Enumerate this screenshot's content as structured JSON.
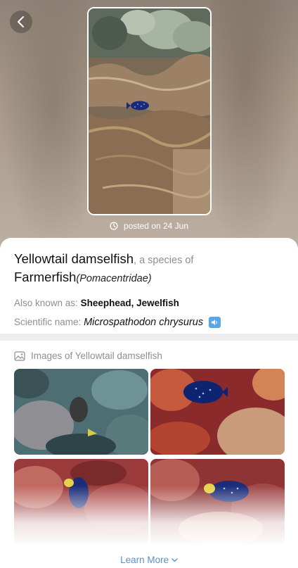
{
  "header": {
    "back_icon": "chevron-left-icon",
    "posted_label": "posted on 24 Jun",
    "posted_icon": "clock-icon"
  },
  "species": {
    "common_name": "Yellowtail damselfish",
    "species_of": ", a species of",
    "family_common": "Farmerfish",
    "family_scientific": "(Pomacentridae)",
    "aka_label": "Also known as: ",
    "aka_value": "Sheephead, Jewelfish",
    "sci_label": "Scientific name: ",
    "sci_value": "Microspathodon chrysurus",
    "speaker_icon": "speaker-icon"
  },
  "images_section": {
    "title": "Images of Yellowtail damselfish",
    "icon": "image-icon",
    "thumbnails": [
      "fish-photo-1",
      "fish-photo-2",
      "fish-photo-3",
      "fish-photo-4"
    ]
  },
  "footer": {
    "learn_more": "Learn More",
    "chevron_icon": "chevron-down-icon"
  },
  "colors": {
    "accent": "#5a8fd0",
    "speaker": "#5aa6e8"
  }
}
